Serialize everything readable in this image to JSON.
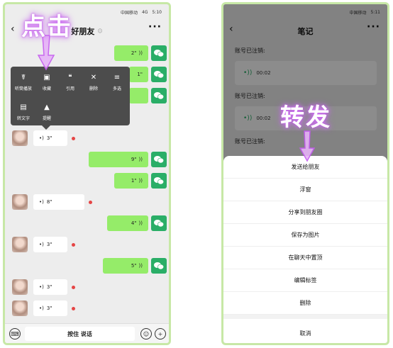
{
  "left": {
    "status": {
      "carrier": "中国移动",
      "signal": "4G",
      "battery": "5:10"
    },
    "title": "好朋友",
    "overlay_label": "点击",
    "messages_out": [
      "2\"",
      "1\"",
      "9\"",
      "1\"",
      "4\"",
      "5\""
    ],
    "messages_in": [
      "3\"",
      "3\"",
      "8\"",
      "3\"",
      "3\"",
      "3\""
    ],
    "menu": [
      {
        "label": "听筒播放",
        "icon": "ear-icon"
      },
      {
        "label": "收藏",
        "icon": "cube-icon"
      },
      {
        "label": "引用",
        "icon": "quote-icon"
      },
      {
        "label": "删除",
        "icon": "trash-icon"
      },
      {
        "label": "多选",
        "icon": "list-icon"
      },
      {
        "label": "转文字",
        "icon": "text-icon"
      },
      {
        "label": "提醒",
        "icon": "bell-icon"
      }
    ],
    "bottom": {
      "hold_label": "按住 说话"
    }
  },
  "right": {
    "status": {
      "carrier": "中国移动",
      "time": "5:11"
    },
    "title": "笔记",
    "overlay_label": "转发",
    "note_labels": [
      "账号已注销:",
      "账号已注销:",
      "账号已注销:"
    ],
    "voice_duration": "00:02",
    "sheet": [
      "发送给朋友",
      "浮窗",
      "分享到朋友圈",
      "保存为图片",
      "在聊天中置顶",
      "编辑标签",
      "删除"
    ],
    "cancel": "取消"
  },
  "colors": {
    "wechat_green": "#2aae67",
    "bubble_green": "#95ec69",
    "frame": "#c7e8a6",
    "glow": "#c45af0"
  }
}
